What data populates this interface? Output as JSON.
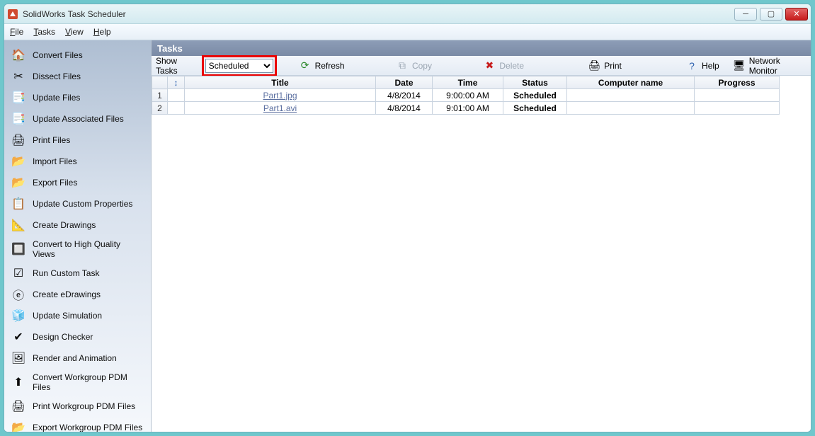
{
  "window": {
    "title": "SolidWorks Task Scheduler",
    "min_tooltip": "Minimize",
    "max_tooltip": "Maximize",
    "close_tooltip": "Close"
  },
  "menubar": {
    "file": "File",
    "tasks": "Tasks",
    "view": "View",
    "help": "Help"
  },
  "sidebar": [
    {
      "label": "Convert Files",
      "icon": "🏠"
    },
    {
      "label": "Dissect Files",
      "icon": "✂"
    },
    {
      "label": "Update Files",
      "icon": "📑"
    },
    {
      "label": "Update Associated Files",
      "icon": "📑"
    },
    {
      "label": "Print Files",
      "icon": "🖨"
    },
    {
      "label": "Import Files",
      "icon": "📂"
    },
    {
      "label": "Export Files",
      "icon": "📂"
    },
    {
      "label": "Update Custom Properties",
      "icon": "📋"
    },
    {
      "label": "Create Drawings",
      "icon": "📐"
    },
    {
      "label": "Convert to High Quality Views",
      "icon": "🔲"
    },
    {
      "label": "Run Custom Task",
      "icon": "☑"
    },
    {
      "label": "Create eDrawings",
      "icon": "ⓔ"
    },
    {
      "label": "Update Simulation",
      "icon": "🧊"
    },
    {
      "label": "Design Checker",
      "icon": "✔"
    },
    {
      "label": "Render and Animation",
      "icon": "🖼"
    },
    {
      "label": "Convert Workgroup PDM Files",
      "icon": "⬆"
    },
    {
      "label": "Print Workgroup PDM Files",
      "icon": "🖨"
    },
    {
      "label": "Export Workgroup PDM Files",
      "icon": "📂"
    }
  ],
  "panel": {
    "title": "Tasks"
  },
  "toolbar": {
    "show_label": "Show Tasks",
    "filter_value": "Scheduled",
    "refresh": "Refresh",
    "copy": "Copy",
    "delete": "Delete",
    "print": "Print",
    "help": "Help",
    "network_monitor": "Network Monitor"
  },
  "grid": {
    "headers": {
      "title": "Title",
      "date": "Date",
      "time": "Time",
      "status": "Status",
      "computer": "Computer name",
      "progress": "Progress"
    },
    "rows": [
      {
        "n": "1",
        "title": "Part1.jpg",
        "date": "4/8/2014",
        "time": "9:00:00 AM",
        "status": "Scheduled",
        "computer": "",
        "progress": ""
      },
      {
        "n": "2",
        "title": "Part1.avi",
        "date": "4/8/2014",
        "time": "9:01:00 AM",
        "status": "Scheduled",
        "computer": "",
        "progress": ""
      }
    ]
  }
}
